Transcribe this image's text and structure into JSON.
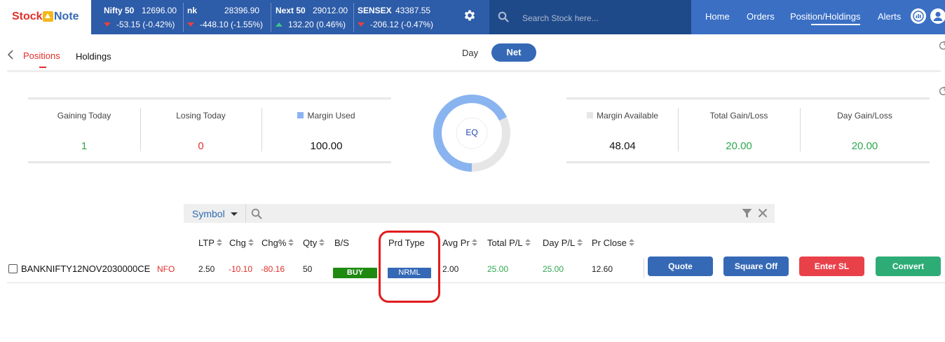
{
  "header": {
    "logo_left": "Stock",
    "logo_right": "Note",
    "tickers": [
      {
        "name": "Nifty 50",
        "value": "12696.00",
        "change": "-53.15 (-0.42%)",
        "direction": "down"
      },
      {
        "name": "nk",
        "value": "28396.90",
        "change": "-448.10 (-1.55%)",
        "direction": "down"
      },
      {
        "name": "Next 50",
        "value": "29012.00",
        "change": "132.20 (0.46%)",
        "direction": "up"
      },
      {
        "name": "SENSEX",
        "value": "43387.55",
        "change": "-206.12 (-0.47%)",
        "direction": "down"
      }
    ],
    "settings_icon": "gear-icon",
    "search_placeholder": "Search Stock here...",
    "nav": [
      "Home",
      "Orders",
      "Position/Holdings",
      "Alerts"
    ],
    "active_nav": "Position/Holdings"
  },
  "tabs": {
    "positions": "Positions",
    "holdings": "Holdings",
    "active": "Positions"
  },
  "toggle": {
    "day": "Day",
    "net": "Net",
    "selected": "Net"
  },
  "summary": {
    "gaining_today": {
      "label": "Gaining Today",
      "value": "1"
    },
    "losing_today": {
      "label": "Losing Today",
      "value": "0"
    },
    "margin_used": {
      "label": "Margin Used",
      "value": "100.00"
    },
    "margin_available": {
      "label": "Margin Available",
      "value": "48.04"
    },
    "total_gain_loss": {
      "label": "Total Gain/Loss",
      "value": "20.00"
    },
    "day_gain_loss": {
      "label": "Day Gain/Loss",
      "value": "20.00"
    },
    "donut_label": "EQ",
    "donut_used_fraction": 0.68
  },
  "filter": {
    "field": "Symbol"
  },
  "table": {
    "columns": [
      "LTP",
      "Chg",
      "Chg%",
      "Qty",
      "B/S",
      "Prd Type",
      "Avg Pr",
      "Total P/L",
      "Day P/L",
      "Pr Close"
    ],
    "rows": [
      {
        "symbol": "BANKNIFTY12NOV2030000CE",
        "exchange": "NFO",
        "ltp": "2.50",
        "chg": "-10.10",
        "chg_pct": "-80.16",
        "qty": "50",
        "bs": "BUY",
        "prd_type": "NRML",
        "avg_pr": "2.00",
        "total_pl": "25.00",
        "day_pl": "25.00",
        "pr_close": "12.60"
      }
    ],
    "actions": [
      "Quote",
      "Square Off",
      "Enter SL",
      "Convert"
    ]
  },
  "colors": {
    "brand_blue": "#3569b6",
    "ticker_bg": "#2d5ca8",
    "search_bg": "#1f4a8a",
    "gain": "#2fa84f",
    "loss": "#e2302b",
    "highlight": "#e21c1c",
    "donut_used": "#8ab4f0",
    "donut_available": "#e6e6e6"
  }
}
